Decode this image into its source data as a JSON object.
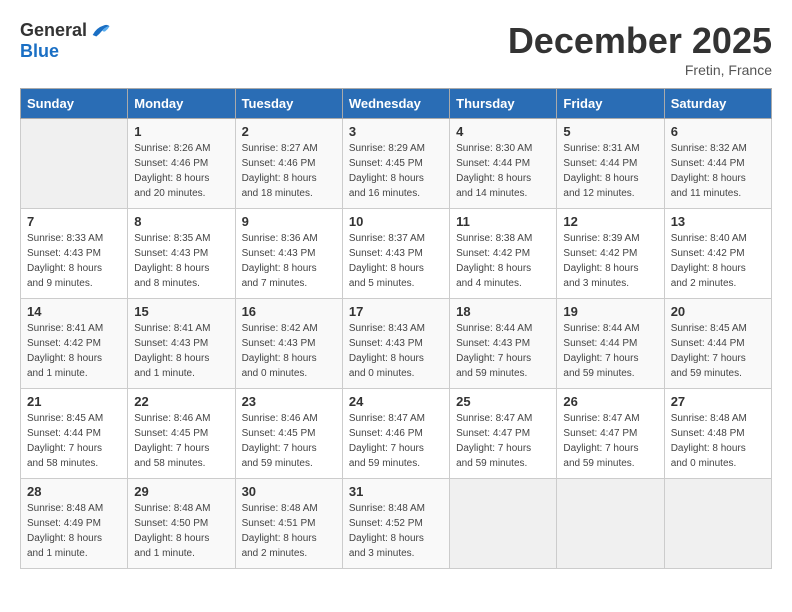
{
  "header": {
    "logo_general": "General",
    "logo_blue": "Blue",
    "month_title": "December 2025",
    "subtitle": "Fretin, France"
  },
  "weekdays": [
    "Sunday",
    "Monday",
    "Tuesday",
    "Wednesday",
    "Thursday",
    "Friday",
    "Saturday"
  ],
  "weeks": [
    [
      {
        "day": "",
        "info": ""
      },
      {
        "day": "1",
        "info": "Sunrise: 8:26 AM\nSunset: 4:46 PM\nDaylight: 8 hours\nand 20 minutes."
      },
      {
        "day": "2",
        "info": "Sunrise: 8:27 AM\nSunset: 4:46 PM\nDaylight: 8 hours\nand 18 minutes."
      },
      {
        "day": "3",
        "info": "Sunrise: 8:29 AM\nSunset: 4:45 PM\nDaylight: 8 hours\nand 16 minutes."
      },
      {
        "day": "4",
        "info": "Sunrise: 8:30 AM\nSunset: 4:44 PM\nDaylight: 8 hours\nand 14 minutes."
      },
      {
        "day": "5",
        "info": "Sunrise: 8:31 AM\nSunset: 4:44 PM\nDaylight: 8 hours\nand 12 minutes."
      },
      {
        "day": "6",
        "info": "Sunrise: 8:32 AM\nSunset: 4:44 PM\nDaylight: 8 hours\nand 11 minutes."
      }
    ],
    [
      {
        "day": "7",
        "info": "Sunrise: 8:33 AM\nSunset: 4:43 PM\nDaylight: 8 hours\nand 9 minutes."
      },
      {
        "day": "8",
        "info": "Sunrise: 8:35 AM\nSunset: 4:43 PM\nDaylight: 8 hours\nand 8 minutes."
      },
      {
        "day": "9",
        "info": "Sunrise: 8:36 AM\nSunset: 4:43 PM\nDaylight: 8 hours\nand 7 minutes."
      },
      {
        "day": "10",
        "info": "Sunrise: 8:37 AM\nSunset: 4:43 PM\nDaylight: 8 hours\nand 5 minutes."
      },
      {
        "day": "11",
        "info": "Sunrise: 8:38 AM\nSunset: 4:42 PM\nDaylight: 8 hours\nand 4 minutes."
      },
      {
        "day": "12",
        "info": "Sunrise: 8:39 AM\nSunset: 4:42 PM\nDaylight: 8 hours\nand 3 minutes."
      },
      {
        "day": "13",
        "info": "Sunrise: 8:40 AM\nSunset: 4:42 PM\nDaylight: 8 hours\nand 2 minutes."
      }
    ],
    [
      {
        "day": "14",
        "info": "Sunrise: 8:41 AM\nSunset: 4:42 PM\nDaylight: 8 hours\nand 1 minute."
      },
      {
        "day": "15",
        "info": "Sunrise: 8:41 AM\nSunset: 4:43 PM\nDaylight: 8 hours\nand 1 minute."
      },
      {
        "day": "16",
        "info": "Sunrise: 8:42 AM\nSunset: 4:43 PM\nDaylight: 8 hours\nand 0 minutes."
      },
      {
        "day": "17",
        "info": "Sunrise: 8:43 AM\nSunset: 4:43 PM\nDaylight: 8 hours\nand 0 minutes."
      },
      {
        "day": "18",
        "info": "Sunrise: 8:44 AM\nSunset: 4:43 PM\nDaylight: 7 hours\nand 59 minutes."
      },
      {
        "day": "19",
        "info": "Sunrise: 8:44 AM\nSunset: 4:44 PM\nDaylight: 7 hours\nand 59 minutes."
      },
      {
        "day": "20",
        "info": "Sunrise: 8:45 AM\nSunset: 4:44 PM\nDaylight: 7 hours\nand 59 minutes."
      }
    ],
    [
      {
        "day": "21",
        "info": "Sunrise: 8:45 AM\nSunset: 4:44 PM\nDaylight: 7 hours\nand 58 minutes."
      },
      {
        "day": "22",
        "info": "Sunrise: 8:46 AM\nSunset: 4:45 PM\nDaylight: 7 hours\nand 58 minutes."
      },
      {
        "day": "23",
        "info": "Sunrise: 8:46 AM\nSunset: 4:45 PM\nDaylight: 7 hours\nand 59 minutes."
      },
      {
        "day": "24",
        "info": "Sunrise: 8:47 AM\nSunset: 4:46 PM\nDaylight: 7 hours\nand 59 minutes."
      },
      {
        "day": "25",
        "info": "Sunrise: 8:47 AM\nSunset: 4:47 PM\nDaylight: 7 hours\nand 59 minutes."
      },
      {
        "day": "26",
        "info": "Sunrise: 8:47 AM\nSunset: 4:47 PM\nDaylight: 7 hours\nand 59 minutes."
      },
      {
        "day": "27",
        "info": "Sunrise: 8:48 AM\nSunset: 4:48 PM\nDaylight: 8 hours\nand 0 minutes."
      }
    ],
    [
      {
        "day": "28",
        "info": "Sunrise: 8:48 AM\nSunset: 4:49 PM\nDaylight: 8 hours\nand 1 minute."
      },
      {
        "day": "29",
        "info": "Sunrise: 8:48 AM\nSunset: 4:50 PM\nDaylight: 8 hours\nand 1 minute."
      },
      {
        "day": "30",
        "info": "Sunrise: 8:48 AM\nSunset: 4:51 PM\nDaylight: 8 hours\nand 2 minutes."
      },
      {
        "day": "31",
        "info": "Sunrise: 8:48 AM\nSunset: 4:52 PM\nDaylight: 8 hours\nand 3 minutes."
      },
      {
        "day": "",
        "info": ""
      },
      {
        "day": "",
        "info": ""
      },
      {
        "day": "",
        "info": ""
      }
    ]
  ]
}
